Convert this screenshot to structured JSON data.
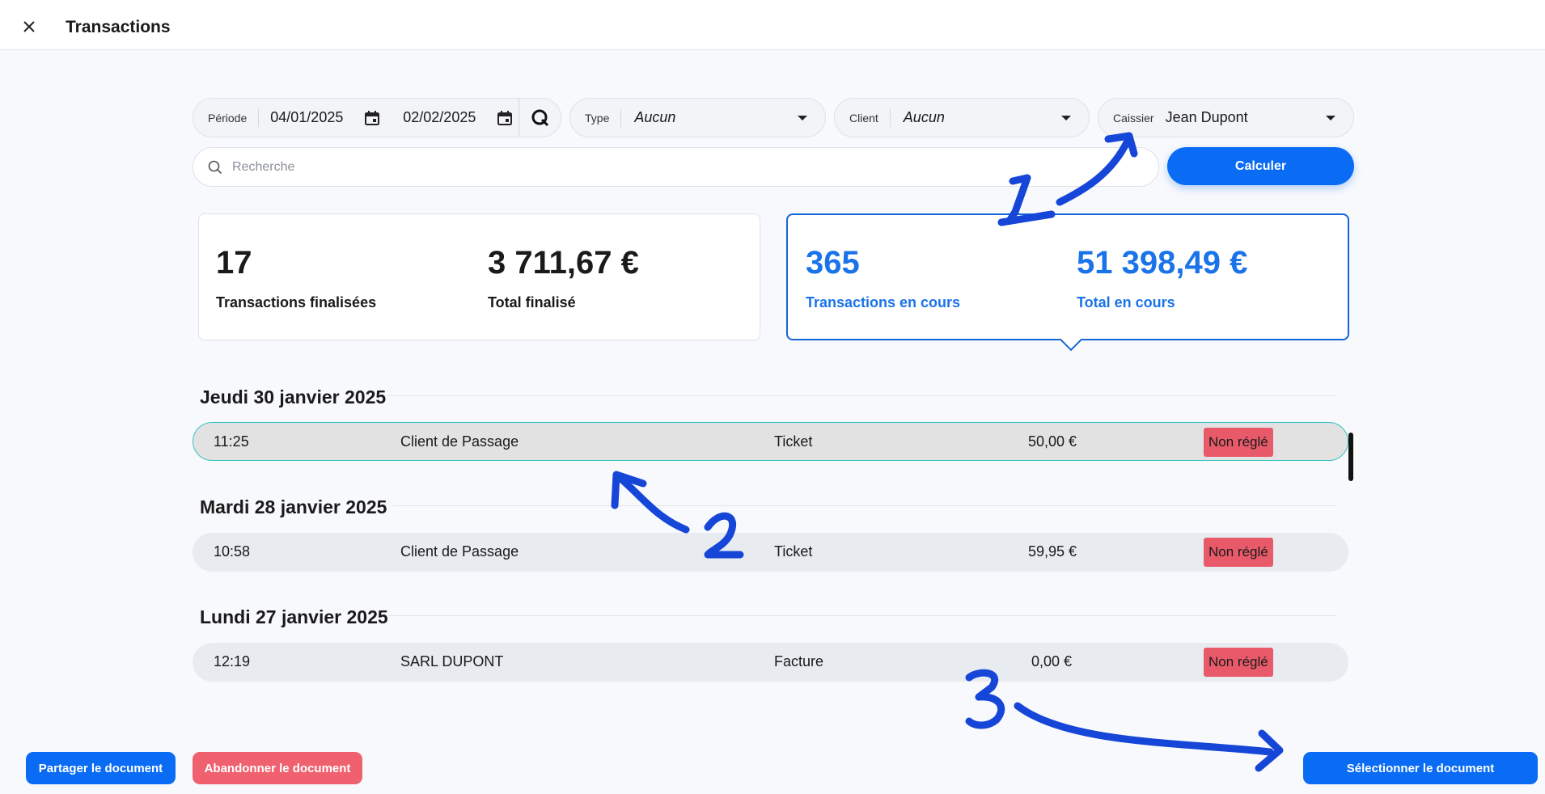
{
  "header": {
    "title": "Transactions"
  },
  "filters": {
    "period": {
      "label": "Période",
      "from": "04/01/2025",
      "to": "02/02/2025"
    },
    "type": {
      "label": "Type",
      "value": "Aucun"
    },
    "client": {
      "label": "Client",
      "value": "Aucun"
    },
    "cashier": {
      "label": "Caissier",
      "value": "Jean Dupont"
    }
  },
  "search": {
    "placeholder": "Recherche"
  },
  "calculate_label": "Calculer",
  "stats": {
    "finalized": {
      "count": "17",
      "count_label": "Transactions finalisées",
      "total": "3 711,67 €",
      "total_label": "Total finalisé"
    },
    "pending": {
      "count": "365",
      "count_label": "Transactions en cours",
      "total": "51 398,49 €",
      "total_label": "Total en cours"
    }
  },
  "groups": [
    {
      "date": "Jeudi 30 janvier 2025",
      "rows": [
        {
          "time": "11:25",
          "client": "Client de Passage",
          "type": "Ticket",
          "amount": "50,00 €",
          "status": "Non réglé"
        }
      ]
    },
    {
      "date": "Mardi 28 janvier 2025",
      "rows": [
        {
          "time": "10:58",
          "client": "Client de Passage",
          "type": "Ticket",
          "amount": "59,95 €",
          "status": "Non réglé"
        }
      ]
    },
    {
      "date": "Lundi 27 janvier 2025",
      "rows": [
        {
          "time": "12:19",
          "client": "SARL DUPONT",
          "type": "Facture",
          "amount": "0,00 €",
          "status": "Non réglé"
        }
      ]
    }
  ],
  "footer": {
    "share": "Partager le document",
    "abandon": "Abandonner le document",
    "select": "Sélectionner le document"
  },
  "colors": {
    "primary": "#0a6cf5",
    "danger": "#f0616f",
    "pending_text": "#1a73e8",
    "annotation": "#1546d8"
  }
}
